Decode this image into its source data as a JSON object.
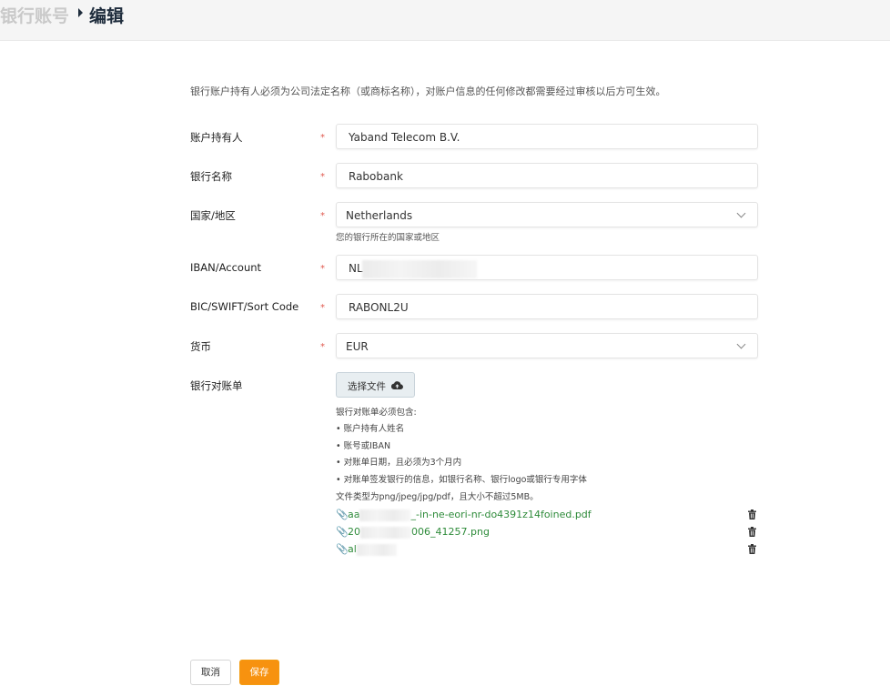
{
  "breadcrumb": {
    "parent": "银行账号",
    "current": "编辑"
  },
  "notice": "银行账户持有人必须为公司法定名称（或商标名称），对账户信息的任何修改都需要经过审核以后方可生效。",
  "required_mark": "*",
  "form": {
    "holder": {
      "label": "账户持有人",
      "value": "Yaband Telecom B.V."
    },
    "bank_name": {
      "label": "银行名称",
      "value": "Rabobank"
    },
    "country": {
      "label": "国家/地区",
      "value": "Netherlands",
      "help": "您的银行所在的国家或地区"
    },
    "iban": {
      "label": "IBAN/Account",
      "value": "NL"
    },
    "bic": {
      "label": "BIC/SWIFT/Sort Code",
      "value": "RABONL2U"
    },
    "currency": {
      "label": "货币",
      "value": "EUR"
    },
    "statement": {
      "label": "银行对账单",
      "upload_label": "选择文件",
      "requirements_title": "银行对账单必须包含:",
      "requirements": [
        "• 账户持有人姓名",
        "• 账号或IBAN",
        "• 对账单日期，且必须为3个月内",
        "• 对账单签发银行的信息，如银行名称、银行logo或银行专用字体"
      ],
      "file_types": "文件类型为png/jpeg/jpg/pdf，且大小不超过5MB。",
      "files": [
        {
          "prefix": "aa",
          "suffix": "_-in-ne-eori-nr-do4391z14foined.pdf"
        },
        {
          "prefix": "20",
          "suffix": "006_41257.png"
        },
        {
          "prefix": "al",
          "suffix": ""
        }
      ]
    }
  },
  "actions": {
    "cancel": "取消",
    "save": "保存"
  },
  "colors": {
    "accent": "#f7920f",
    "required": "#e05a4f",
    "file_link": "#2e8b3a",
    "title": "#1f2d3d"
  },
  "icons": {
    "upload": "cloud-upload-icon",
    "attachment": "paperclip-icon",
    "delete": "trash-icon",
    "dropdown": "chevron-down-icon"
  }
}
